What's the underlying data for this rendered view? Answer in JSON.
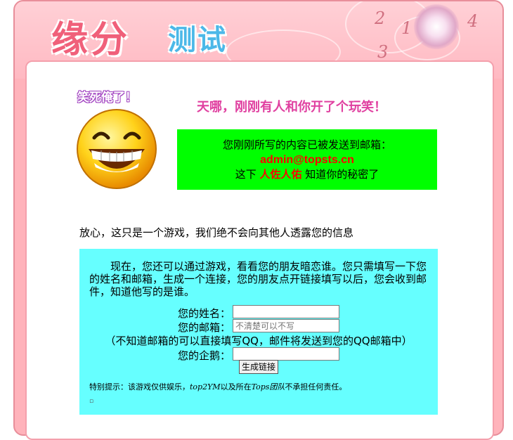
{
  "header": {
    "title_main": "缘分",
    "title_sub": "测试",
    "deco_numbers": [
      "1",
      "2",
      "3",
      "4"
    ]
  },
  "result": {
    "laugh_caption": "笑死俺了！",
    "headline": "天哪，刚刚有人和你开了个玩笑！",
    "sent_line": "您刚刚所写的内容已被发送到邮箱：",
    "email": "admin@topsts.cn",
    "this_time_prefix": "这下",
    "who": "人佐人佑",
    "this_time_suffix": "知道你的秘密了"
  },
  "reassure": "放心，这只是一个游戏，我们绝不会向其他人透露您的信息",
  "form": {
    "intro": "现在，您还可以通过游戏，看看您的朋友暗恋谁。您只需填写一下您的姓名和邮箱，生成一个连接，您的朋友点开链接填写以后，您会收到邮件，知道他写的是谁。",
    "name_label": "您的姓名：",
    "name_value": "",
    "email_label": "您的邮箱：",
    "email_placeholder": "不清楚可以不写",
    "note": "（不知道邮箱的可以直接填写QQ，邮件将发送到您的QQ邮箱中）",
    "qq_label": "您的企鹅：",
    "qq_value": "",
    "submit_label": "生成链接",
    "tip_prefix": "特别提示：该游戏仅供娱乐，",
    "tip_italic1": "top2YM",
    "tip_mid": "以及所在",
    "tip_italic2": "Tops团队",
    "tip_suffix": "不承担任何责任。"
  },
  "colors": {
    "frame": "#ffb3bb",
    "green_box": "#00ff00",
    "cyan_box": "#66ffff",
    "headline": "#e040a0",
    "highlight": "#ff0000"
  }
}
